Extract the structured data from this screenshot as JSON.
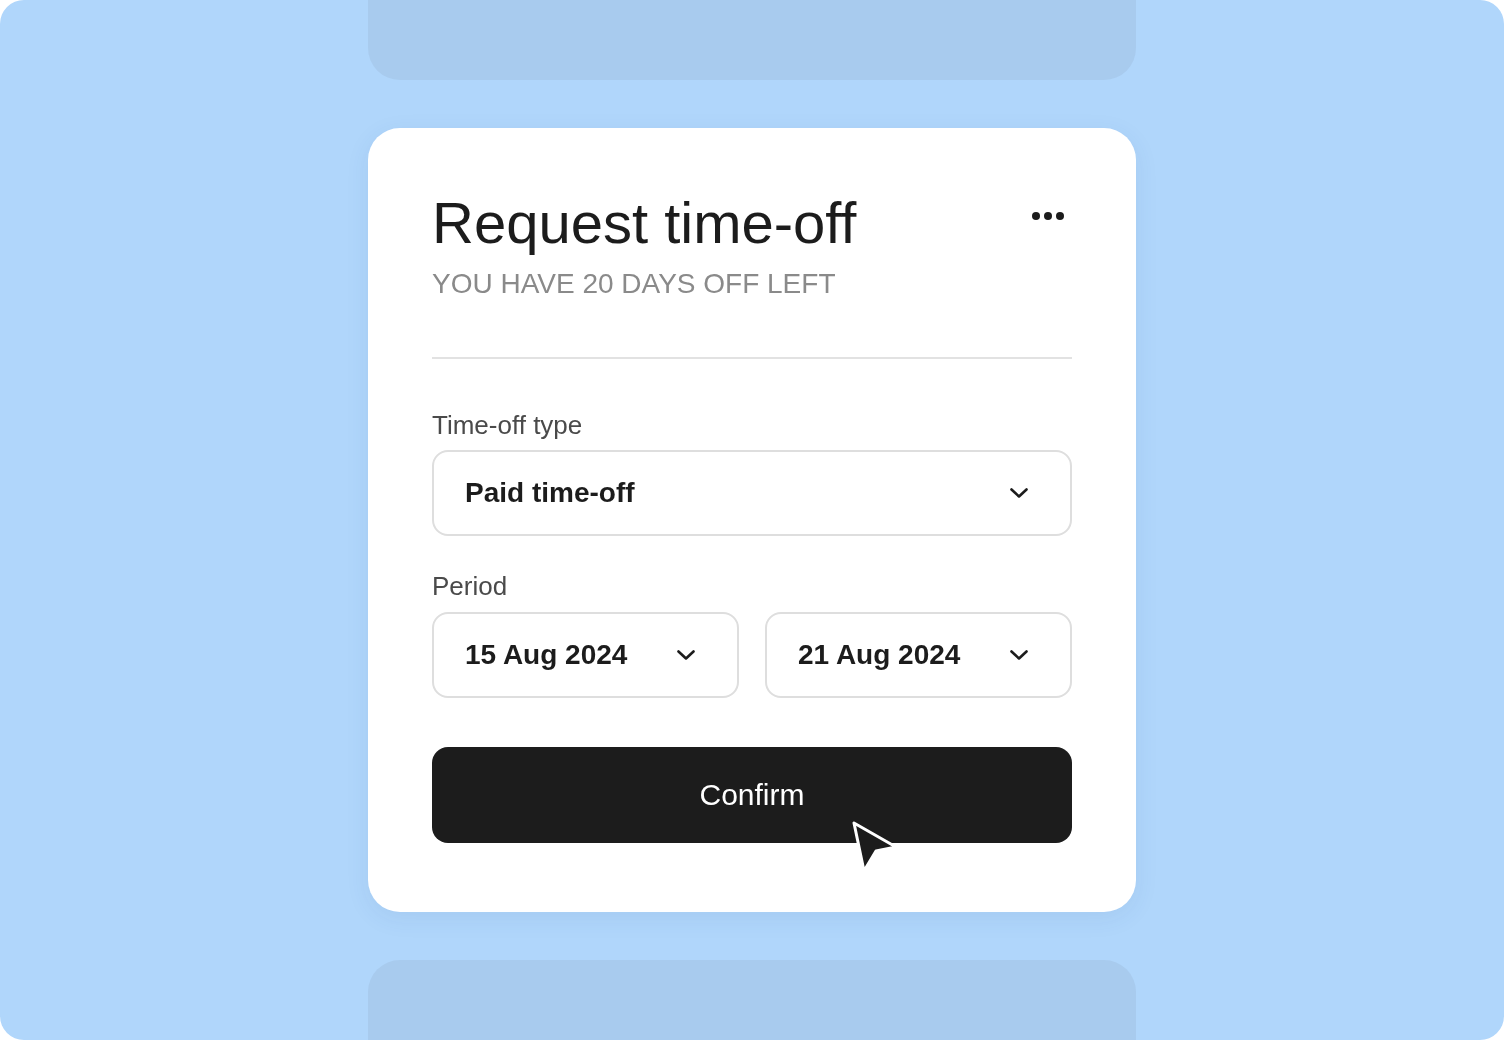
{
  "card": {
    "title": "Request time-off",
    "subtitle": "YOU HAVE 20 DAYS OFF LEFT"
  },
  "time_off_type": {
    "label": "Time-off type",
    "value": "Paid time-off"
  },
  "period": {
    "label": "Period",
    "start": "15 Aug 2024",
    "end": "21 Aug 2024"
  },
  "confirm_button": {
    "label": "Confirm"
  }
}
